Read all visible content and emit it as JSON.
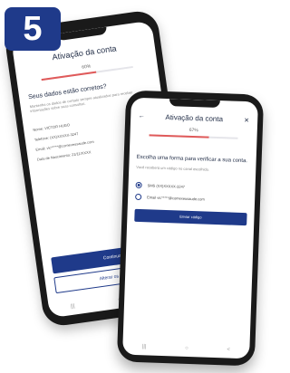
{
  "badge": {
    "step": "5"
  },
  "back_phone": {
    "title": "Ativação da conta",
    "progress": {
      "label": "60%",
      "value": 0.6
    },
    "heading": "Seus dados estão corretos?",
    "description": "Mantenha os dados de contato sempre atualizados para receber informações sobre suas consultas.",
    "fields": [
      "Nome: VICTOR HUGO",
      "Telefone: (XX)XXXXX-3247",
      "Email: vic*****@comexeusaude.com",
      "Data de Nascimento: 21/11/XXXX"
    ],
    "continue_label": "Continuar",
    "change_label": "Alterar os dados",
    "nav_icons": [
      "|||",
      "○",
      "<"
    ]
  },
  "front_phone": {
    "title": "Ativação da conta",
    "back_icon": "←",
    "close_icon": "✕",
    "progress": {
      "label": "67%",
      "value": 0.67
    },
    "heading": "Escolha uma forma para verificar a sua conta.",
    "subtext": "Você receberá um código no canal escolhido.",
    "options": [
      {
        "label": "SMS (XX)XXXXX-3247",
        "selected": true
      },
      {
        "label": "Email vic*****@comexeusaude.com",
        "selected": false
      }
    ],
    "send_label": "Enviar código",
    "nav_icons": [
      "|||",
      "○",
      "<"
    ]
  }
}
